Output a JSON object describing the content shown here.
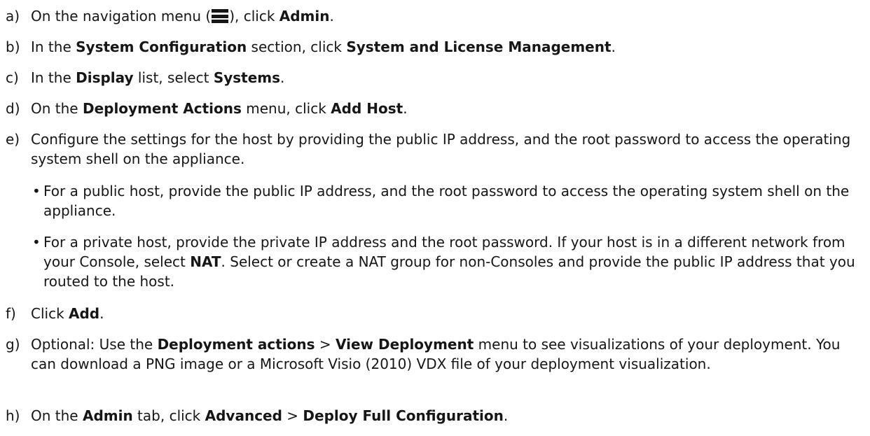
{
  "steps": {
    "a": {
      "marker": "a)",
      "t1": "On the navigation menu (",
      "t2": "), click ",
      "b1": "Admin",
      "t3": ".",
      "icon": "hamburger-menu-icon"
    },
    "b": {
      "marker": "b)",
      "t1": "In the ",
      "b1": "System Configuration",
      "t2": " section, click ",
      "b2": "System and License Management",
      "t3": "."
    },
    "c": {
      "marker": "c)",
      "t1": "In the ",
      "b1": "Display",
      "t2": " list, select ",
      "b2": "Systems",
      "t3": "."
    },
    "d": {
      "marker": "d)",
      "t1": "On the ",
      "b1": "Deployment Actions",
      "t2": " menu, click ",
      "b2": "Add Host",
      "t3": "."
    },
    "e": {
      "marker": "e)",
      "text": "Configure the settings for the host by providing the public IP address, and the root password to access the operating system shell on the appliance.",
      "bullets": [
        {
          "symbol": "•",
          "text": "For a public host, provide the public IP address, and the root password to access the operating system shell on the appliance."
        },
        {
          "symbol": "•",
          "t1": "For a private host, provide the private IP address and the root password. If your host is in a different network from your Console, select ",
          "b1": "NAT",
          "t2": ". Select or create a NAT group for non-Consoles and provide the public IP address that you routed to the host."
        }
      ]
    },
    "f": {
      "marker": "f)",
      "t1": "Click ",
      "b1": "Add",
      "t2": "."
    },
    "g": {
      "marker": "g)",
      "t1": "Optional: Use the ",
      "b1": "Deployment actions",
      "t2": " > ",
      "b2": "View Deployment",
      "t3": " menu to see visualizations of your deployment. You can download a PNG image or a Microsoft Visio (2010) VDX file of your deployment visualization."
    },
    "h": {
      "marker": "h)",
      "t1": "On the ",
      "b1": "Admin",
      "t2": " tab, click ",
      "b2": "Advanced",
      "t3": " > ",
      "b3": "Deploy Full Configuration",
      "t4": "."
    }
  }
}
